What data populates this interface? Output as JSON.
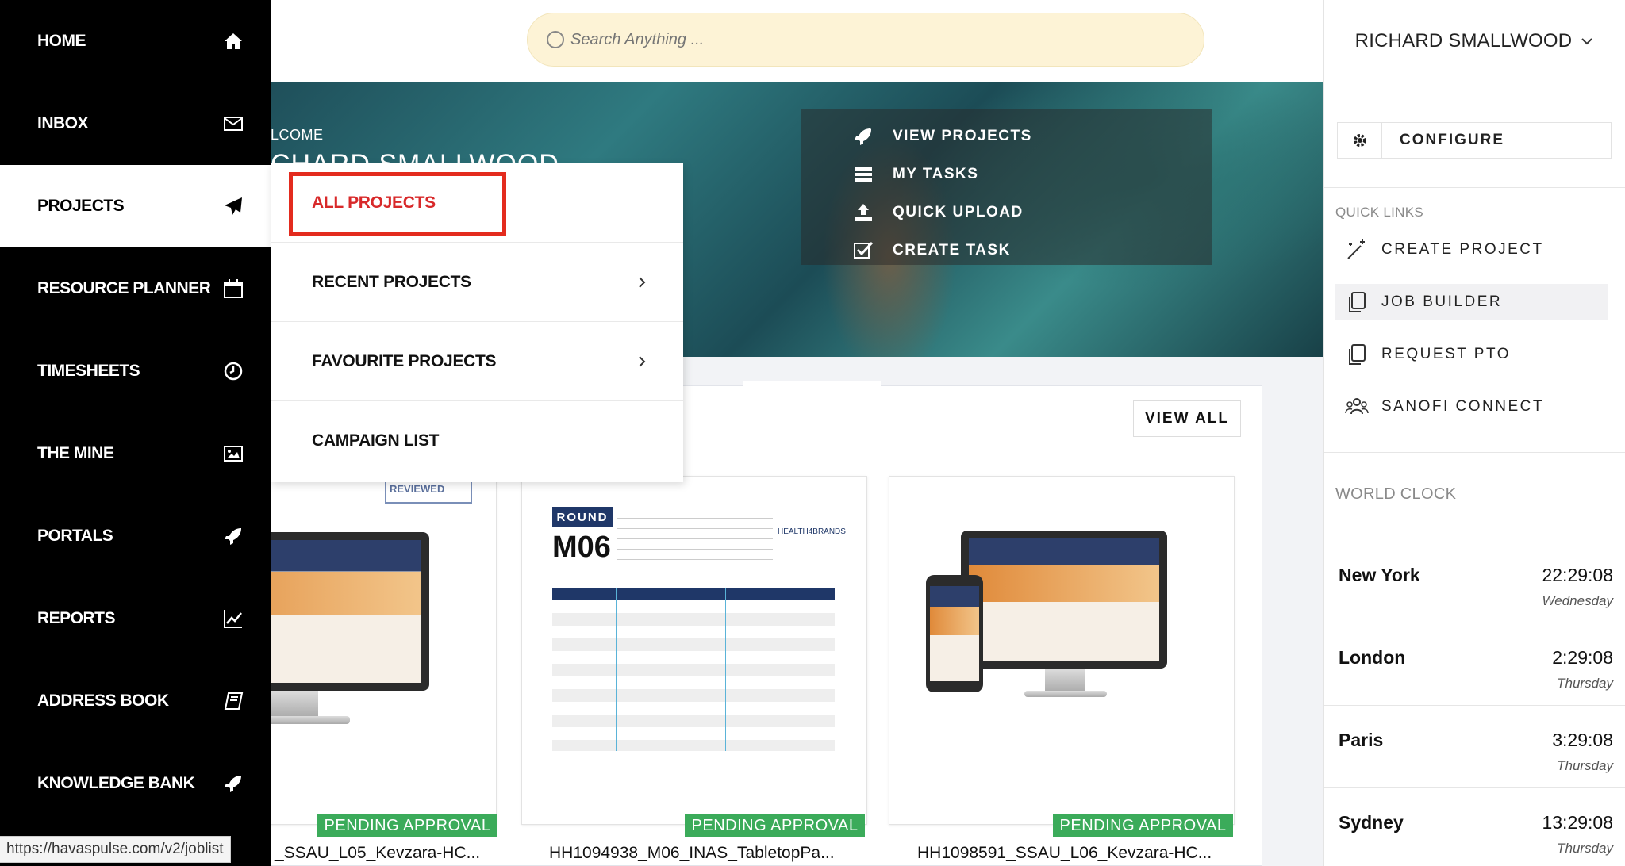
{
  "sidebar": {
    "items": [
      {
        "label": "HOME",
        "icon": "home-icon"
      },
      {
        "label": "INBOX",
        "icon": "envelope-icon"
      },
      {
        "label": "PROJECTS",
        "icon": "paper-plane-icon",
        "active": true
      },
      {
        "label": "RESOURCE PLANNER",
        "icon": "calendar-icon"
      },
      {
        "label": "TIMESHEETS",
        "icon": "clock-icon"
      },
      {
        "label": "THE MINE",
        "icon": "image-icon"
      },
      {
        "label": "PORTALS",
        "icon": "rocket-icon"
      },
      {
        "label": "REPORTS",
        "icon": "line-chart-icon"
      },
      {
        "label": "ADDRESS BOOK",
        "icon": "book-icon"
      },
      {
        "label": "KNOWLEDGE BANK",
        "icon": "rocket-icon"
      }
    ]
  },
  "search": {
    "placeholder": "Search Anything ..."
  },
  "user": {
    "name": "RICHARD SMALLWOOD"
  },
  "hero": {
    "welcome": "LCOME",
    "name": "CHARD SMALLWOOD",
    "actions": [
      {
        "label": "VIEW PROJECTS",
        "icon": "rocket-icon"
      },
      {
        "label": "MY TASKS",
        "icon": "list-icon"
      },
      {
        "label": "QUICK UPLOAD",
        "icon": "upload-icon"
      },
      {
        "label": "CREATE TASK",
        "icon": "checkbox-icon"
      }
    ]
  },
  "dropdown": {
    "items": [
      {
        "label": "ALL PROJECTS"
      },
      {
        "label": "RECENT PROJECTS",
        "has_submenu": true
      },
      {
        "label": "FAVOURITE PROJECTS",
        "has_submenu": true
      },
      {
        "label": "CAMPAIGN LIST"
      }
    ]
  },
  "content": {
    "view_all": "VIEW ALL",
    "cards": [
      {
        "badge": "PENDING APPROVAL",
        "name": "_SSAU_L05_Kevzara-HC...",
        "stamp": "REVIEWED"
      },
      {
        "badge": "PENDING APPROVAL",
        "name": "HH1094938_M06_INAS_TabletopPa...",
        "round_label": "ROUND",
        "round_code": "M06",
        "brand": "HEALTH4BRANDS"
      },
      {
        "badge": "PENDING APPROVAL",
        "name": "HH1098591_SSAU_L06_Kevzara-HC..."
      }
    ]
  },
  "right_panel": {
    "configure": "CONFIGURE",
    "quick_links_heading": "QUICK LINKS",
    "quick_links": [
      {
        "label": "CREATE PROJECT",
        "icon": "magic-wand-icon"
      },
      {
        "label": "JOB BUILDER",
        "icon": "copy-icon",
        "active": true
      },
      {
        "label": "REQUEST PTO",
        "icon": "copy-icon"
      },
      {
        "label": "SANOFI CONNECT",
        "icon": "users-icon"
      }
    ],
    "world_clock_heading": "WORLD CLOCK",
    "clocks": [
      {
        "city": "New York",
        "time": "22:29:08",
        "day": "Wednesday"
      },
      {
        "city": "London",
        "time": "2:29:08",
        "day": "Thursday"
      },
      {
        "city": "Paris",
        "time": "3:29:08",
        "day": "Thursday"
      },
      {
        "city": "Sydney",
        "time": "13:29:08",
        "day": "Thursday"
      }
    ]
  },
  "status_bar": {
    "url": "https://havaspulse.com/v2/joblist"
  },
  "colors": {
    "sidebar_bg": "#000000",
    "accent_red": "#e32b1e",
    "badge_green": "#3bab5a",
    "search_bg": "#fdf3d6"
  }
}
